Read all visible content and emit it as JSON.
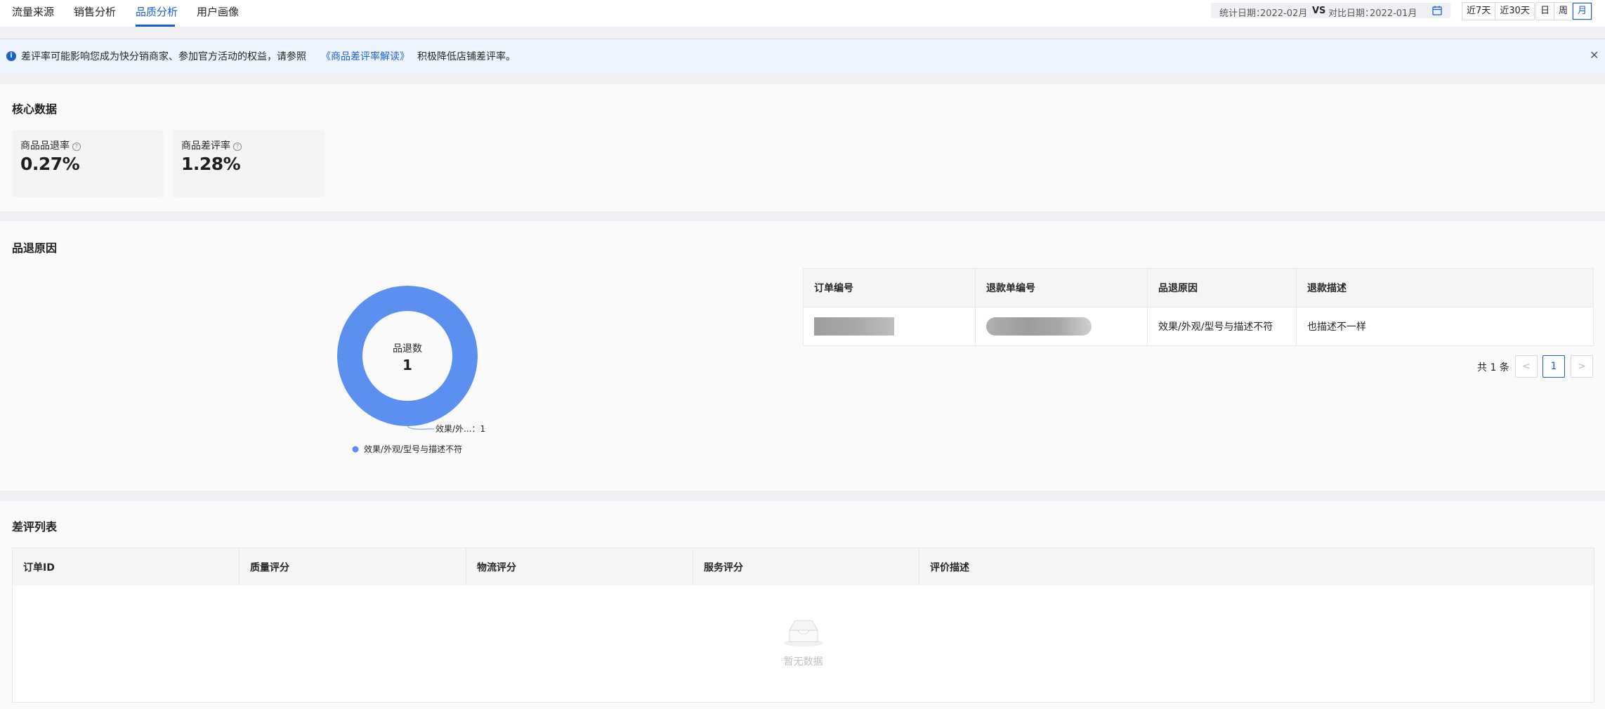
{
  "nav": {
    "tabs": [
      {
        "label": "流量来源"
      },
      {
        "label": "销售分析"
      },
      {
        "label": "品质分析"
      },
      {
        "label": "用户画像"
      }
    ],
    "active_tab": "品质分析"
  },
  "date_filter": {
    "stat_label": "统计日期：",
    "stat_value": "2022-02月",
    "vs": "VS",
    "compare_label": "对比日期：",
    "compare_value": "2022-01月",
    "quick_ranges": [
      "近7天",
      "近30天"
    ],
    "granularity": [
      "日",
      "周",
      "月"
    ],
    "active_granularity": "月"
  },
  "notice": {
    "text_before": "差评率可能影响您成为快分销商家、参加官方活动的权益，请参照",
    "link": "《商品差评率解读》",
    "text_after": "积极降低店铺差评率。"
  },
  "core": {
    "title": "核心数据",
    "metrics": [
      {
        "label": "商品品退率",
        "value": "0.27%"
      },
      {
        "label": "商品差评率",
        "value": "1.28%"
      }
    ]
  },
  "returns": {
    "title": "品退原因",
    "chart_data": {
      "type": "pie",
      "center_label": "品退数",
      "center_value": "1",
      "slices": [
        {
          "name": "效果/外观/型号与描述不符",
          "value": 1
        }
      ],
      "slice_label": "效果/外...：1",
      "color": "#5b8ff0"
    },
    "table": {
      "headers": [
        "订单编号",
        "退款单编号",
        "品退原因",
        "退款描述"
      ],
      "rows": [
        {
          "reason": "效果/外观/型号与描述不符",
          "desc": "也描述不一样"
        }
      ]
    },
    "pager": {
      "total": "共 1 条",
      "current": "1"
    }
  },
  "reviews": {
    "title": "差评列表",
    "headers": [
      "订单ID",
      "质量评分",
      "物流评分",
      "服务评分",
      "评价描述"
    ],
    "empty_text": "暂无数据"
  },
  "colors": {
    "accent": "#1b5fd6",
    "donut": "#5b8ff0"
  }
}
